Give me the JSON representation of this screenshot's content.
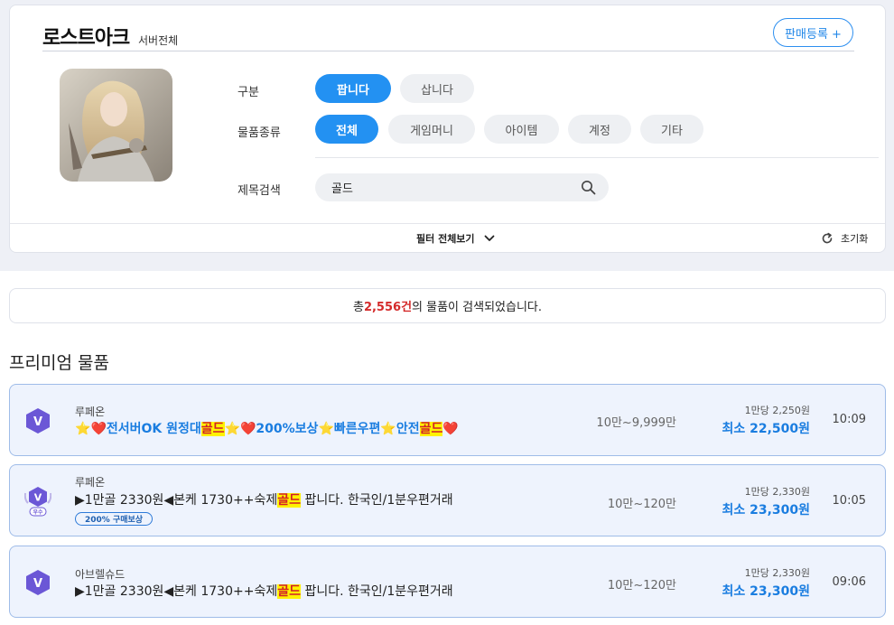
{
  "game": {
    "title": "로스트아크",
    "server": "서버전체",
    "register_label": "판매등록 +"
  },
  "filters": {
    "type_label": "구분",
    "type_options": [
      "팝니다",
      "삽니다"
    ],
    "category_label": "물품종류",
    "category_options": [
      "전체",
      "게임머니",
      "아이템",
      "계정",
      "기타"
    ],
    "search_label": "제목검색",
    "search_value": "골드",
    "show_all_label": "필터 전체보기",
    "reset_label": "초기화"
  },
  "results": {
    "prefix": "총 ",
    "count": "2,556건",
    "suffix": "의 물품이 검색되었습니다."
  },
  "section_title": "프리미엄 물품",
  "items": [
    {
      "server": "루페온",
      "title_parts": [
        "⭐",
        "❤️",
        "전서버OK 원정대",
        "골드",
        "⭐",
        "❤️",
        "200%보상",
        "⭐",
        "빠른우편",
        "⭐",
        "안전",
        "골드",
        "❤️"
      ],
      "range": "10만~9,999만",
      "unit_price": "1만당 2,250원",
      "min_price": "최소 22,500원",
      "time": "10:09",
      "badge": "V"
    },
    {
      "server": "루페온",
      "title_parts": [
        "▶1만골 2330원◀본케 1730++숙제",
        "골드",
        " 팝니다. 한국인/1분우편거래"
      ],
      "tag": "200% 구매보상",
      "range": "10만~120만",
      "unit_price": "1만당 2,330원",
      "min_price": "최소 23,300원",
      "time": "10:05",
      "badge": "V",
      "badge_sub": "우수"
    },
    {
      "server": "아브렐슈드",
      "title_parts": [
        "▶1만골 2330원◀본케 1730++숙제",
        "골드",
        " 팝니다. 한국인/1분우편거래"
      ],
      "range": "10만~120만",
      "unit_price": "1만당 2,330원",
      "min_price": "최소 23,300원",
      "time": "09:06",
      "badge": "V"
    }
  ],
  "colors": {
    "accent": "#2391f2",
    "highlight_bg": "#fff200",
    "highlight_text": "#d1202a",
    "count": "#d42a2a"
  },
  "icons": {
    "search": "search-icon",
    "chevron": "chevron-down-icon",
    "reset": "refresh-icon",
    "badge": "grade-badge-icon"
  }
}
